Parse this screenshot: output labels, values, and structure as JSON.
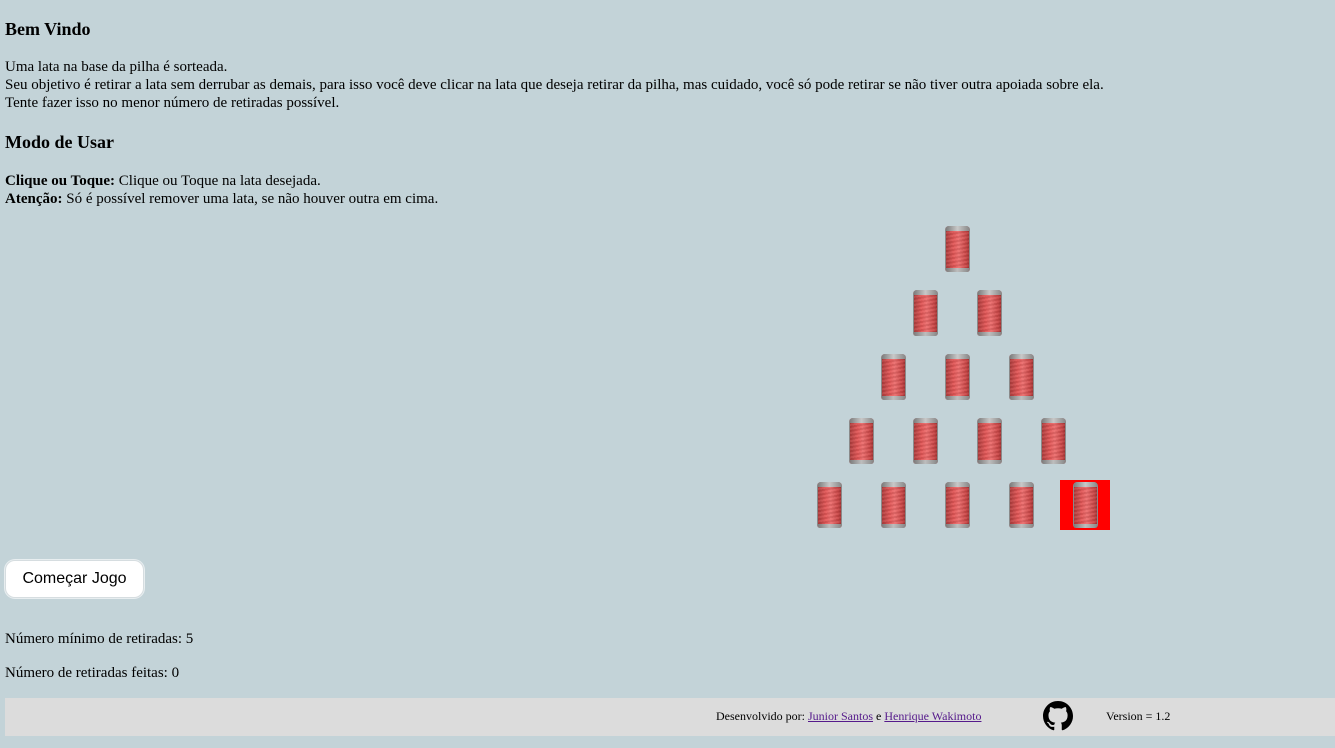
{
  "welcome": {
    "title": "Bem Vindo",
    "lines": [
      "Uma lata na base da pilha é sorteada.",
      "Seu objetivo é retirar a lata sem derrubar as demais, para isso você deve clicar na lata que deseja retirar da pilha, mas cuidado, você só pode retirar se não tiver outra apoiada sobre ela.",
      "Tente fazer isso no menor número de retiradas possível."
    ]
  },
  "usage": {
    "title": "Modo de Usar",
    "items": [
      {
        "label": "Clique ou Toque:",
        "text": " Clique ou Toque na lata desejada."
      },
      {
        "label": "Atenção:",
        "text": " Só é possível remover uma lata, se não houver outra em cima."
      }
    ]
  },
  "game": {
    "pyramid_rows": [
      1,
      2,
      3,
      4,
      5
    ],
    "drawn_can": {
      "row": 5,
      "position": 5
    },
    "highlight_color": "#ff0000",
    "can_icon": "soda-can-icon"
  },
  "controls": {
    "start_button": "Começar Jogo"
  },
  "stats": {
    "min_label": "Número mínimo de retiradas: ",
    "min_value": "5",
    "done_label": "Número de retiradas feitas: ",
    "done_value": "0"
  },
  "footer": {
    "developed_by": "Desenvolvido por: ",
    "author1": "Junior Santos",
    "conjunction": " e ",
    "author2": "Henrique Wakimoto",
    "github_icon": "github-icon",
    "version": "Version = 1.2"
  },
  "colors": {
    "background": "#c3d3d8",
    "footer_background": "#dcdcdc",
    "link": "#551a8b"
  }
}
